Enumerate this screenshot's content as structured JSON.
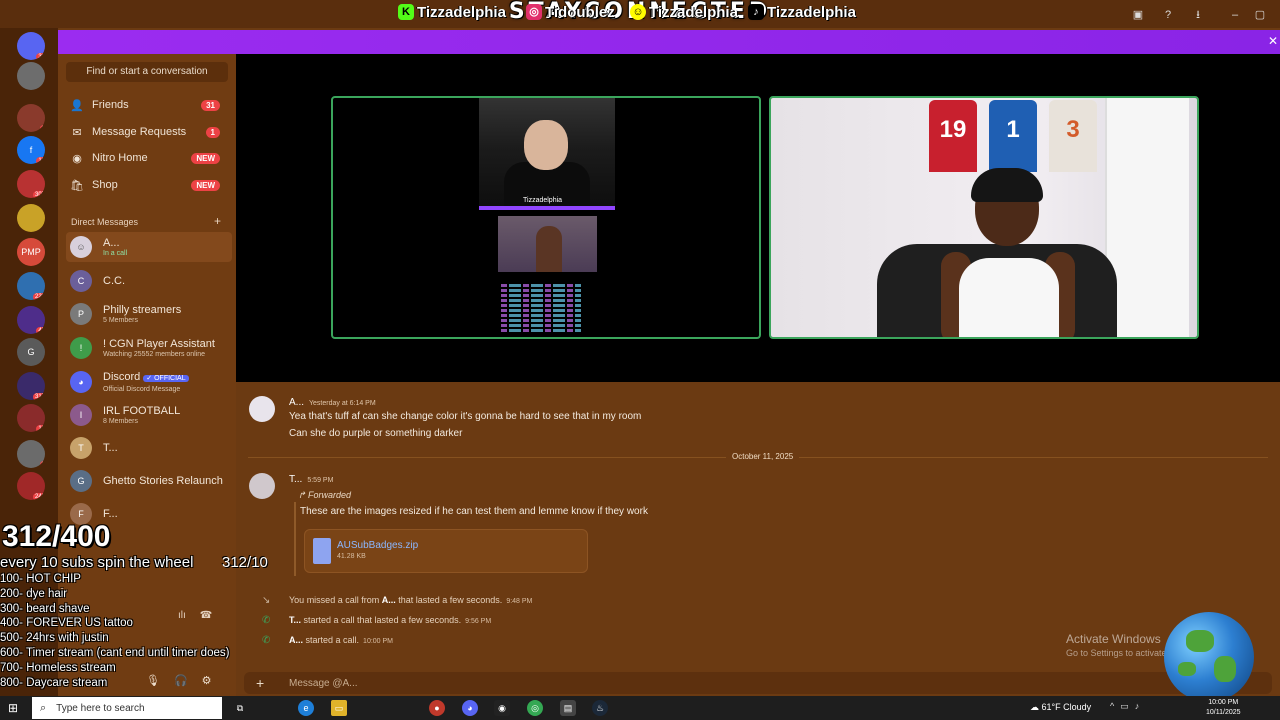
{
  "overlay_banner": "STAYCONNECTED",
  "social_bar": {
    "items": [
      {
        "platform_icon": "kick-icon",
        "handle": "Tizzadelphia",
        "color": "#53fc18"
      },
      {
        "platform_icon": "instagram-icon",
        "handle": "Tidoublez",
        "color": "#e1306c"
      },
      {
        "platform_icon": "snapchat-icon",
        "handle": "Tizzadelphia",
        "color": "#fffc00"
      },
      {
        "platform_icon": "tiktok-icon",
        "handle": "Tizzadelphia",
        "color": "#000000"
      }
    ]
  },
  "sidebar": {
    "search_label": "Find or start a conversation",
    "nav": [
      {
        "icon": "friends-icon",
        "label": "Friends",
        "badge": "31"
      },
      {
        "icon": "envelope-icon",
        "label": "Message Requests",
        "badge": "1"
      },
      {
        "icon": "nitro-icon",
        "label": "Nitro Home",
        "badge": "NEW"
      },
      {
        "icon": "shop-icon",
        "label": "Shop",
        "badge": "NEW"
      }
    ],
    "dm_header": "Direct Messages",
    "dms": [
      {
        "name": "A...",
        "sub": "In a call",
        "selected": true
      },
      {
        "name": "C.C.",
        "sub": ""
      },
      {
        "name": "Philly streamers",
        "sub": "5 Members"
      },
      {
        "name": "! CGN Player Assistant",
        "sub": "Watching 25552 members online"
      },
      {
        "name": "Discord",
        "tag": "✓ OFFICIAL",
        "sub": "Official Discord Message"
      },
      {
        "name": "IRL FOOTBALL",
        "sub": "8 Members"
      },
      {
        "name": "T...",
        "sub": ""
      },
      {
        "name": "Ghetto Stories Relaunch",
        "sub": ""
      },
      {
        "name": "F...",
        "sub": ""
      }
    ]
  },
  "servers": [
    {
      "label": "",
      "badge": "32"
    },
    {
      "label": "",
      "badge": ""
    },
    {
      "label": "",
      "badge": "2"
    },
    {
      "label": "f",
      "badge": "13"
    },
    {
      "label": "",
      "badge": "307"
    },
    {
      "label": "",
      "badge": ""
    },
    {
      "label": "PMP",
      "badge": ""
    },
    {
      "label": "",
      "badge": "229"
    },
    {
      "label": "",
      "badge": "45"
    },
    {
      "label": "G",
      "badge": ""
    },
    {
      "label": "",
      "badge": "317"
    },
    {
      "label": "",
      "badge": "19"
    },
    {
      "label": "",
      "badge": "9"
    },
    {
      "label": "",
      "badge": "243"
    }
  ],
  "messages": {
    "m1": {
      "author": "A...",
      "time": "Yesterday at 6:14 PM",
      "lines": [
        "Yea that's tuff af can she change color it's gonna be hard to see that in my room",
        "Can she do purple or something darker"
      ]
    },
    "divider": "October 11, 2025",
    "m2": {
      "author": "T...",
      "time": "5:59 PM",
      "forwarded_label": "Forwarded",
      "text": "These are the images resized if he can test them and lemme know if they work",
      "attachment": {
        "name": "AUSubBadges.zip",
        "size": "41.28 KB"
      }
    },
    "sys1": {
      "pre": "You missed a call from ",
      "who": "A...",
      "post": " that lasted a few seconds.",
      "time": "9:48 PM"
    },
    "sys2": {
      "who": "T...",
      "post": " started a call that lasted a few seconds.",
      "time": "9:56 PM"
    },
    "sys3": {
      "who": "A...",
      "post": " started a call.",
      "time": "10:00 PM"
    }
  },
  "composer_placeholder": "Message @A...",
  "stream_overlay": {
    "goal": "312/400",
    "wheel_text": "every 10 subs spin the wheel",
    "wheel_count": "312/10",
    "rewards": [
      "100- HOT CHIP",
      "200- dye hair",
      "300- beard shave",
      "400- FOREVER US tattoo",
      "500- 24hrs with justin",
      "600- Timer stream (cant end until timer does)",
      "700- Homeless stream",
      "800- Daycare stream"
    ]
  },
  "video_tiles": {
    "streamer_label": "Tizzadelphia"
  },
  "windows_watermark": {
    "line1": "Activate Windows",
    "line2": "Go to Settings to activate Windows."
  },
  "taskbar": {
    "search_placeholder": "Type here to search",
    "weather": "61°F  Cloudy",
    "time": "10:00 PM",
    "date": "10/11/2025"
  }
}
